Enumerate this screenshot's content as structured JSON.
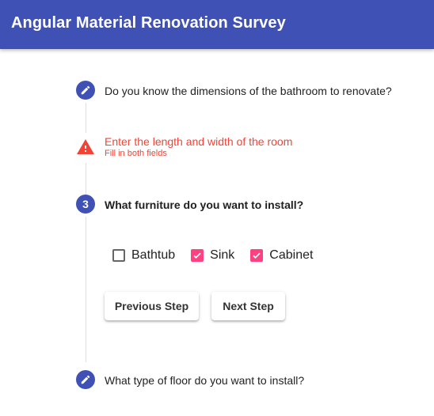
{
  "app": {
    "title": "Angular Material Renovation Survey"
  },
  "steps": [
    {
      "indicator_icon": "pencil-icon",
      "label": "Do you know the dimensions of the bathroom to renovate?"
    },
    {
      "indicator_icon": "warning-icon",
      "label": "Enter the length and width of the room",
      "error_hint": "Fill in both fields"
    },
    {
      "number": "3",
      "label": "What furniture do you want to install?"
    },
    {
      "indicator_icon": "pencil-icon",
      "label": "What type of floor do you want to install?"
    }
  ],
  "furniture": {
    "options": [
      {
        "label": "Bathtub",
        "checked": false
      },
      {
        "label": "Sink",
        "checked": true
      },
      {
        "label": "Cabinet",
        "checked": true
      }
    ]
  },
  "buttons": {
    "previous": "Previous Step",
    "next": "Next Step"
  },
  "colors": {
    "primary": "#3f51b5",
    "accent": "#ff4081",
    "error": "#f44336"
  }
}
